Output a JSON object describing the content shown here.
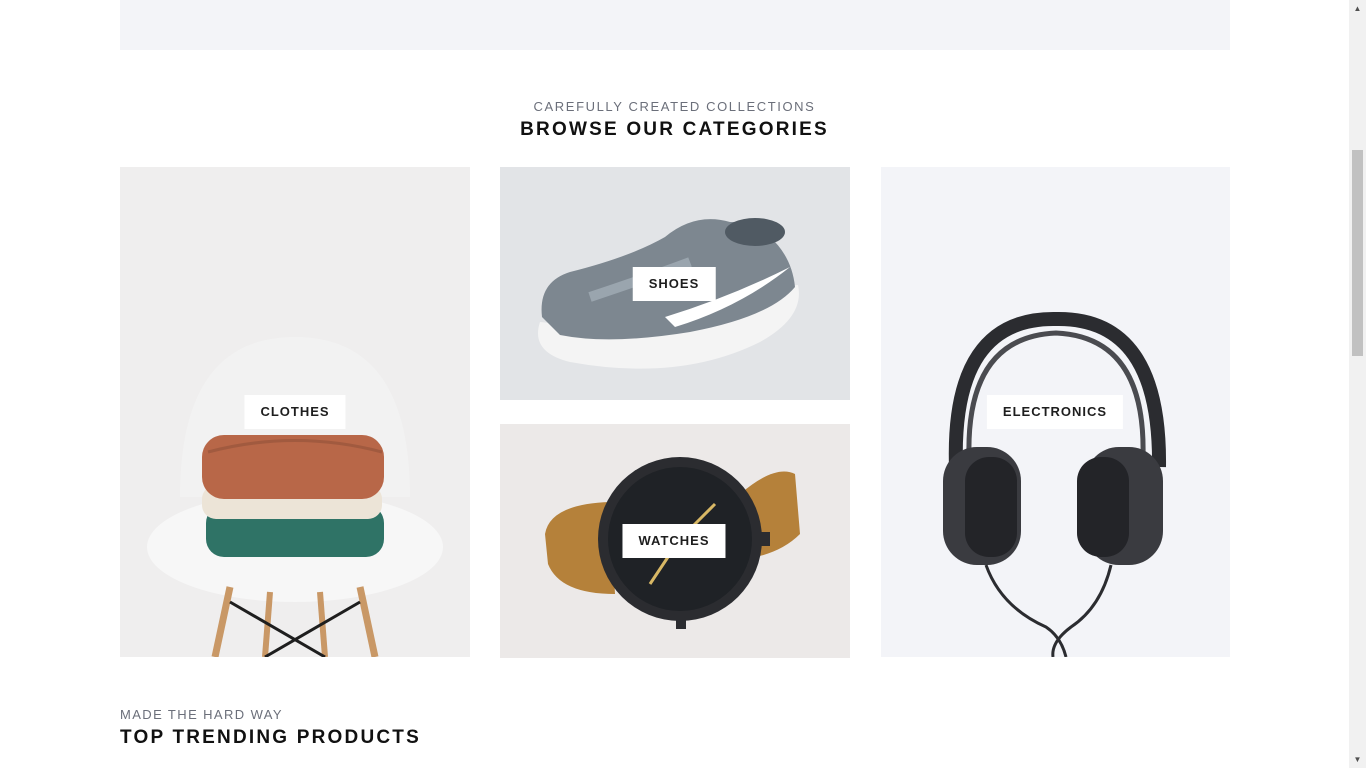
{
  "categories_section": {
    "subtitle": "CAREFULLY CREATED COLLECTIONS",
    "title": "BROWSE OUR CATEGORIES",
    "cards": [
      {
        "label": "CLOTHES"
      },
      {
        "label": "SHOES"
      },
      {
        "label": "WATCHES"
      },
      {
        "label": "ELECTRONICS"
      }
    ]
  },
  "trending_section": {
    "subtitle": "MADE THE HARD WAY",
    "title": "TOP TRENDING PRODUCTS"
  },
  "scrollbar": {
    "up_arrow": "▲",
    "down_arrow": "▼"
  },
  "colors": {
    "page_bg": "#ffffff",
    "band_bg": "#f3f4f8",
    "label_bg": "#ffffff",
    "text_dark": "#111111",
    "text_muted": "#6b6f7a"
  }
}
